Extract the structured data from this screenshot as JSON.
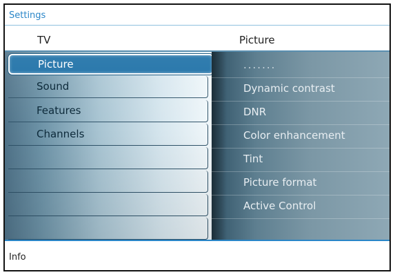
{
  "header": {
    "title": "Settings"
  },
  "left_column": {
    "title": "TV",
    "items": [
      {
        "label": "Picture",
        "selected": true
      },
      {
        "label": "Sound"
      },
      {
        "label": "Features"
      },
      {
        "label": "Channels"
      },
      {
        "label": ""
      },
      {
        "label": ""
      },
      {
        "label": ""
      },
      {
        "label": ""
      }
    ]
  },
  "right_column": {
    "title": "Picture",
    "items": [
      {
        "label": "......."
      },
      {
        "label": "Dynamic contrast"
      },
      {
        "label": "DNR"
      },
      {
        "label": "Color enhancement"
      },
      {
        "label": "Tint"
      },
      {
        "label": "Picture format"
      },
      {
        "label": "Active Control"
      },
      {
        "label": ""
      }
    ]
  },
  "footer": {
    "info_label": "Info"
  },
  "colors": {
    "accent": "#2a86c8",
    "selected": "#1b6fa6"
  }
}
